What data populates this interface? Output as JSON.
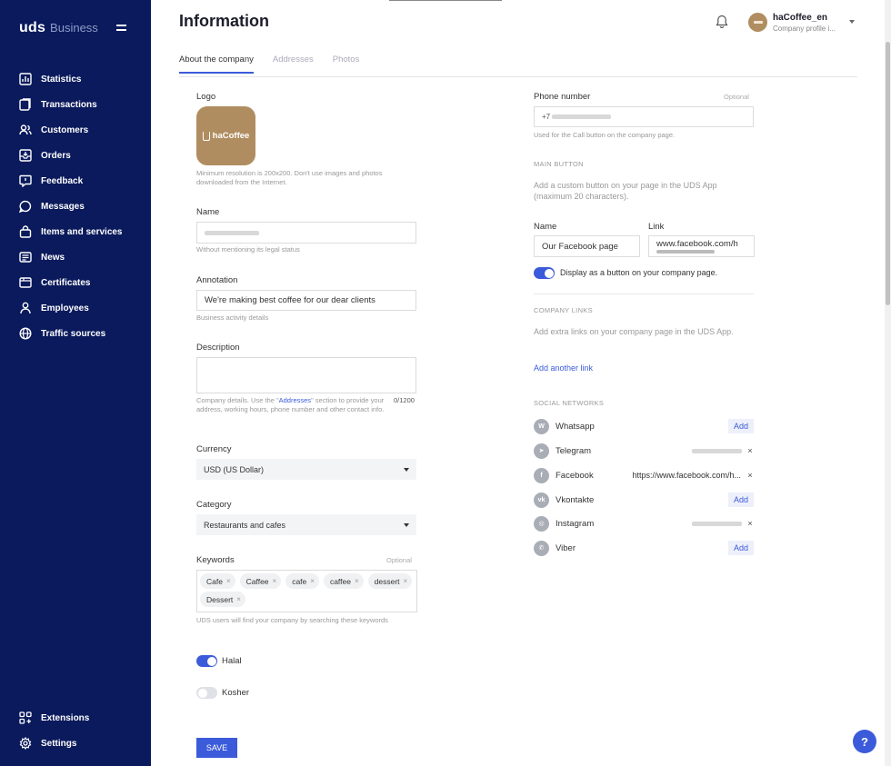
{
  "brand": {
    "name": "uds",
    "suffix": "Business"
  },
  "sidebar": {
    "items": [
      {
        "label": "Statistics",
        "icon": "chart-icon"
      },
      {
        "label": "Transactions",
        "icon": "transactions-icon"
      },
      {
        "label": "Customers",
        "icon": "customers-icon"
      },
      {
        "label": "Orders",
        "icon": "orders-icon"
      },
      {
        "label": "Feedback",
        "icon": "feedback-icon"
      },
      {
        "label": "Messages",
        "icon": "messages-icon"
      },
      {
        "label": "Items and services",
        "icon": "bag-icon"
      },
      {
        "label": "News",
        "icon": "news-icon"
      },
      {
        "label": "Certificates",
        "icon": "certificate-icon"
      },
      {
        "label": "Employees",
        "icon": "employee-icon"
      },
      {
        "label": "Traffic sources",
        "icon": "globe-icon"
      }
    ],
    "bottom": [
      {
        "label": "Extensions",
        "icon": "extensions-icon"
      },
      {
        "label": "Settings",
        "icon": "gear-icon"
      }
    ]
  },
  "header": {
    "title": "Information",
    "profile_name": "haCoffee_en",
    "profile_sub": "Company profile i..."
  },
  "tabs": [
    {
      "label": "About the company",
      "active": true
    },
    {
      "label": "Addresses",
      "active": false
    },
    {
      "label": "Photos",
      "active": false
    }
  ],
  "left": {
    "logo_label": "Logo",
    "logo_text": "haCoffee",
    "logo_hint": "Minimum resolution is 200x200. Don't use images and photos downloaded from the Internet.",
    "name_label": "Name",
    "name_hint": "Without mentioning its legal status",
    "annotation_label": "Annotation",
    "annotation_value": "We're making best coffee for our dear clients",
    "annotation_hint": "Business activity details",
    "description_label": "Description",
    "description_hint_pre": "Company details. Use the \"",
    "description_hint_link": "Addresses",
    "description_hint_post": "\" section to provide your address, working hours, phone number and other contact info.",
    "description_count": "0/1200",
    "currency_label": "Currency",
    "currency_value": "USD (US Dollar)",
    "category_label": "Category",
    "category_value": "Restaurants and cafes",
    "keywords_label": "Keywords",
    "keywords_optional": "Optional",
    "keywords": [
      "Cafe",
      "Caffee",
      "cafe",
      "caffee",
      "dessert",
      "Dessert"
    ],
    "keywords_hint": "UDS users will find your company by searching these keywords",
    "halal_label": "Halal",
    "halal_on": true,
    "kosher_label": "Kosher",
    "kosher_on": false,
    "save_label": "SAVE"
  },
  "right": {
    "phone_label": "Phone number",
    "phone_optional": "Optional",
    "phone_prefix": "+7",
    "phone_hint": "Used for the Call button on the company page.",
    "main_button_head": "MAIN BUTTON",
    "main_button_hint": "Add a custom button on your page in the UDS App (maximum 20 characters).",
    "name_label": "Name",
    "name_value": "Our Facebook page",
    "link_label": "Link",
    "link_value": "www.facebook.com/h",
    "display_label": "Display as a button on your company page.",
    "display_on": true,
    "company_links_head": "COMPANY LINKS",
    "company_links_hint": "Add extra links on your company page in the UDS App.",
    "add_link_label": "Add another link",
    "social_head": "SOCIAL NETWORKS",
    "social": [
      {
        "name": "Whatsapp",
        "action": "Add",
        "icon": "whatsapp-icon"
      },
      {
        "name": "Telegram",
        "value": "",
        "icon": "telegram-icon"
      },
      {
        "name": "Facebook",
        "value": "https://www.facebook.com/h...",
        "icon": "facebook-icon"
      },
      {
        "name": "Vkontakte",
        "action": "Add",
        "icon": "vk-icon"
      },
      {
        "name": "Instagram",
        "value": "",
        "icon": "instagram-icon"
      },
      {
        "name": "Viber",
        "action": "Add",
        "icon": "viber-icon"
      }
    ]
  },
  "help_label": "?"
}
